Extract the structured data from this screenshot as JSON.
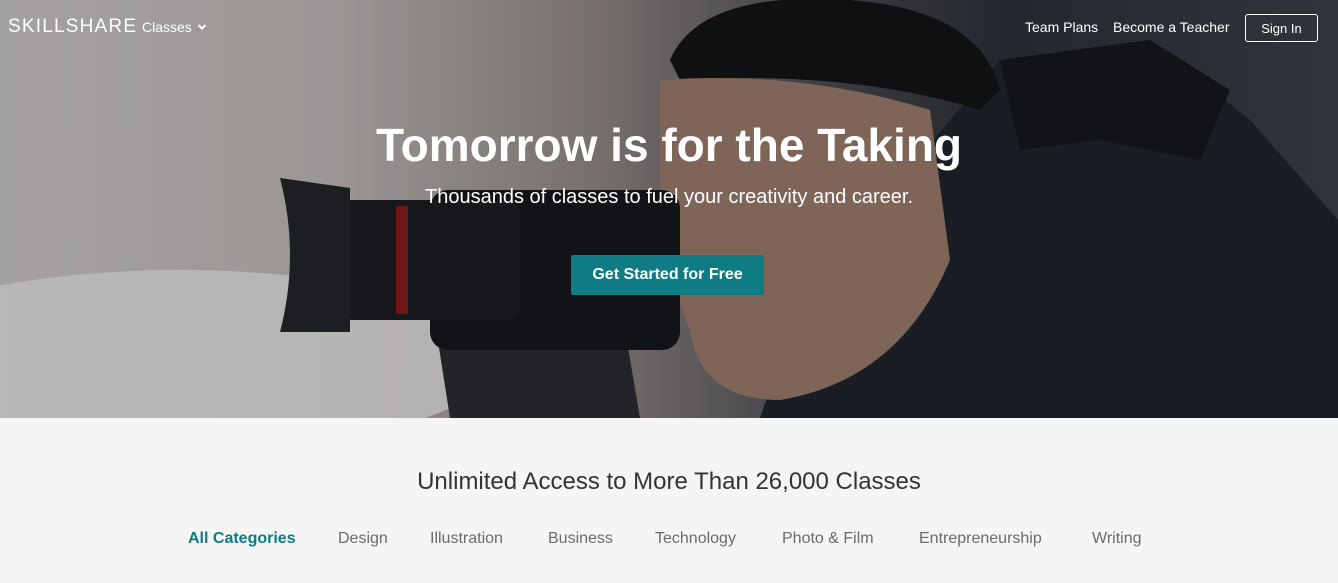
{
  "nav": {
    "logo": "SKILLSHARE",
    "classes_label": "Classes",
    "team_plans": "Team Plans",
    "become_teacher": "Become a Teacher",
    "sign_in": "Sign In"
  },
  "hero": {
    "title": "Tomorrow is for the Taking",
    "subtitle": "Thousands of classes to fuel your creativity and career.",
    "cta": "Get Started for Free"
  },
  "catalog": {
    "title": "Unlimited Access to More Than 26,000 Classes",
    "categories": [
      "All Categories",
      "Design",
      "Illustration",
      "Business",
      "Technology",
      "Photo & Film",
      "Entrepreneurship",
      "Writing"
    ],
    "active_category": "All Categories"
  },
  "colors": {
    "accent": "#0f7c83",
    "background": "#f5f5f5"
  }
}
